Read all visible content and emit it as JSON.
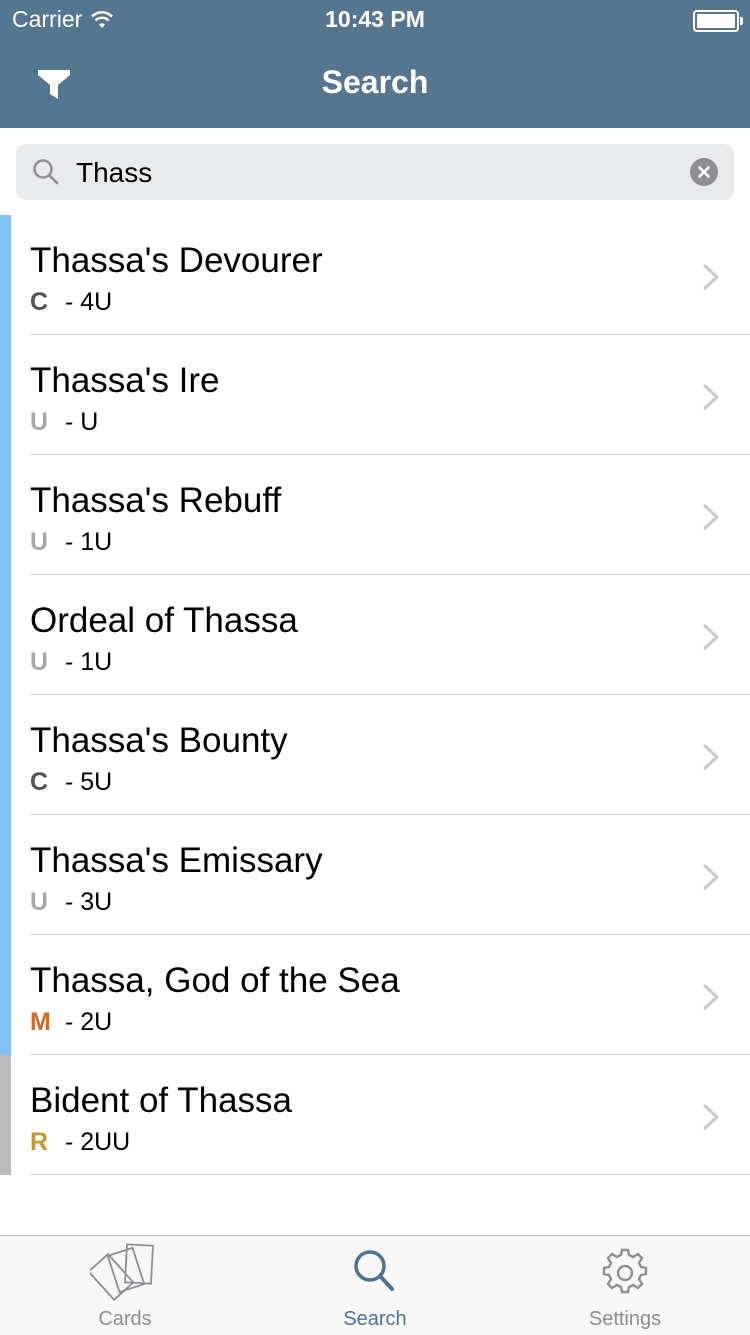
{
  "status_bar": {
    "carrier": "Carrier",
    "time": "10:43 PM"
  },
  "nav": {
    "title": "Search",
    "left_icon": "filter-icon"
  },
  "search": {
    "value": "Thass",
    "placeholder": ""
  },
  "colors": {
    "nav_background": "#547691",
    "rarity_common": "#555555",
    "rarity_uncommon": "#a7a7a7",
    "rarity_rare": "#c39a25",
    "rarity_mythic": "#d8661b",
    "tab_active": "#4f7390",
    "tab_inactive": "#8e8e93"
  },
  "results": [
    {
      "name": "Thassa's Devourer",
      "rarity": "C",
      "rarity_type": "common",
      "cost": "4U"
    },
    {
      "name": "Thassa's Ire",
      "rarity": "U",
      "rarity_type": "uncommon",
      "cost": "U"
    },
    {
      "name": "Thassa's Rebuff",
      "rarity": "U",
      "rarity_type": "uncommon",
      "cost": "1U"
    },
    {
      "name": "Ordeal of Thassa",
      "rarity": "U",
      "rarity_type": "uncommon",
      "cost": "1U"
    },
    {
      "name": "Thassa's Bounty",
      "rarity": "C",
      "rarity_type": "common",
      "cost": "5U"
    },
    {
      "name": "Thassa's Emissary",
      "rarity": "U",
      "rarity_type": "uncommon",
      "cost": "3U"
    },
    {
      "name": "Thassa, God of the Sea",
      "rarity": "M",
      "rarity_type": "mythic",
      "cost": "2U"
    },
    {
      "name": "Bident of Thassa",
      "rarity": "R",
      "rarity_type": "rare",
      "cost": "2UU"
    }
  ],
  "separator": " - ",
  "tabs": [
    {
      "label": "Cards",
      "icon": "cards-icon",
      "active": false
    },
    {
      "label": "Search",
      "icon": "search-icon",
      "active": true
    },
    {
      "label": "Settings",
      "icon": "gear-icon",
      "active": false
    }
  ]
}
